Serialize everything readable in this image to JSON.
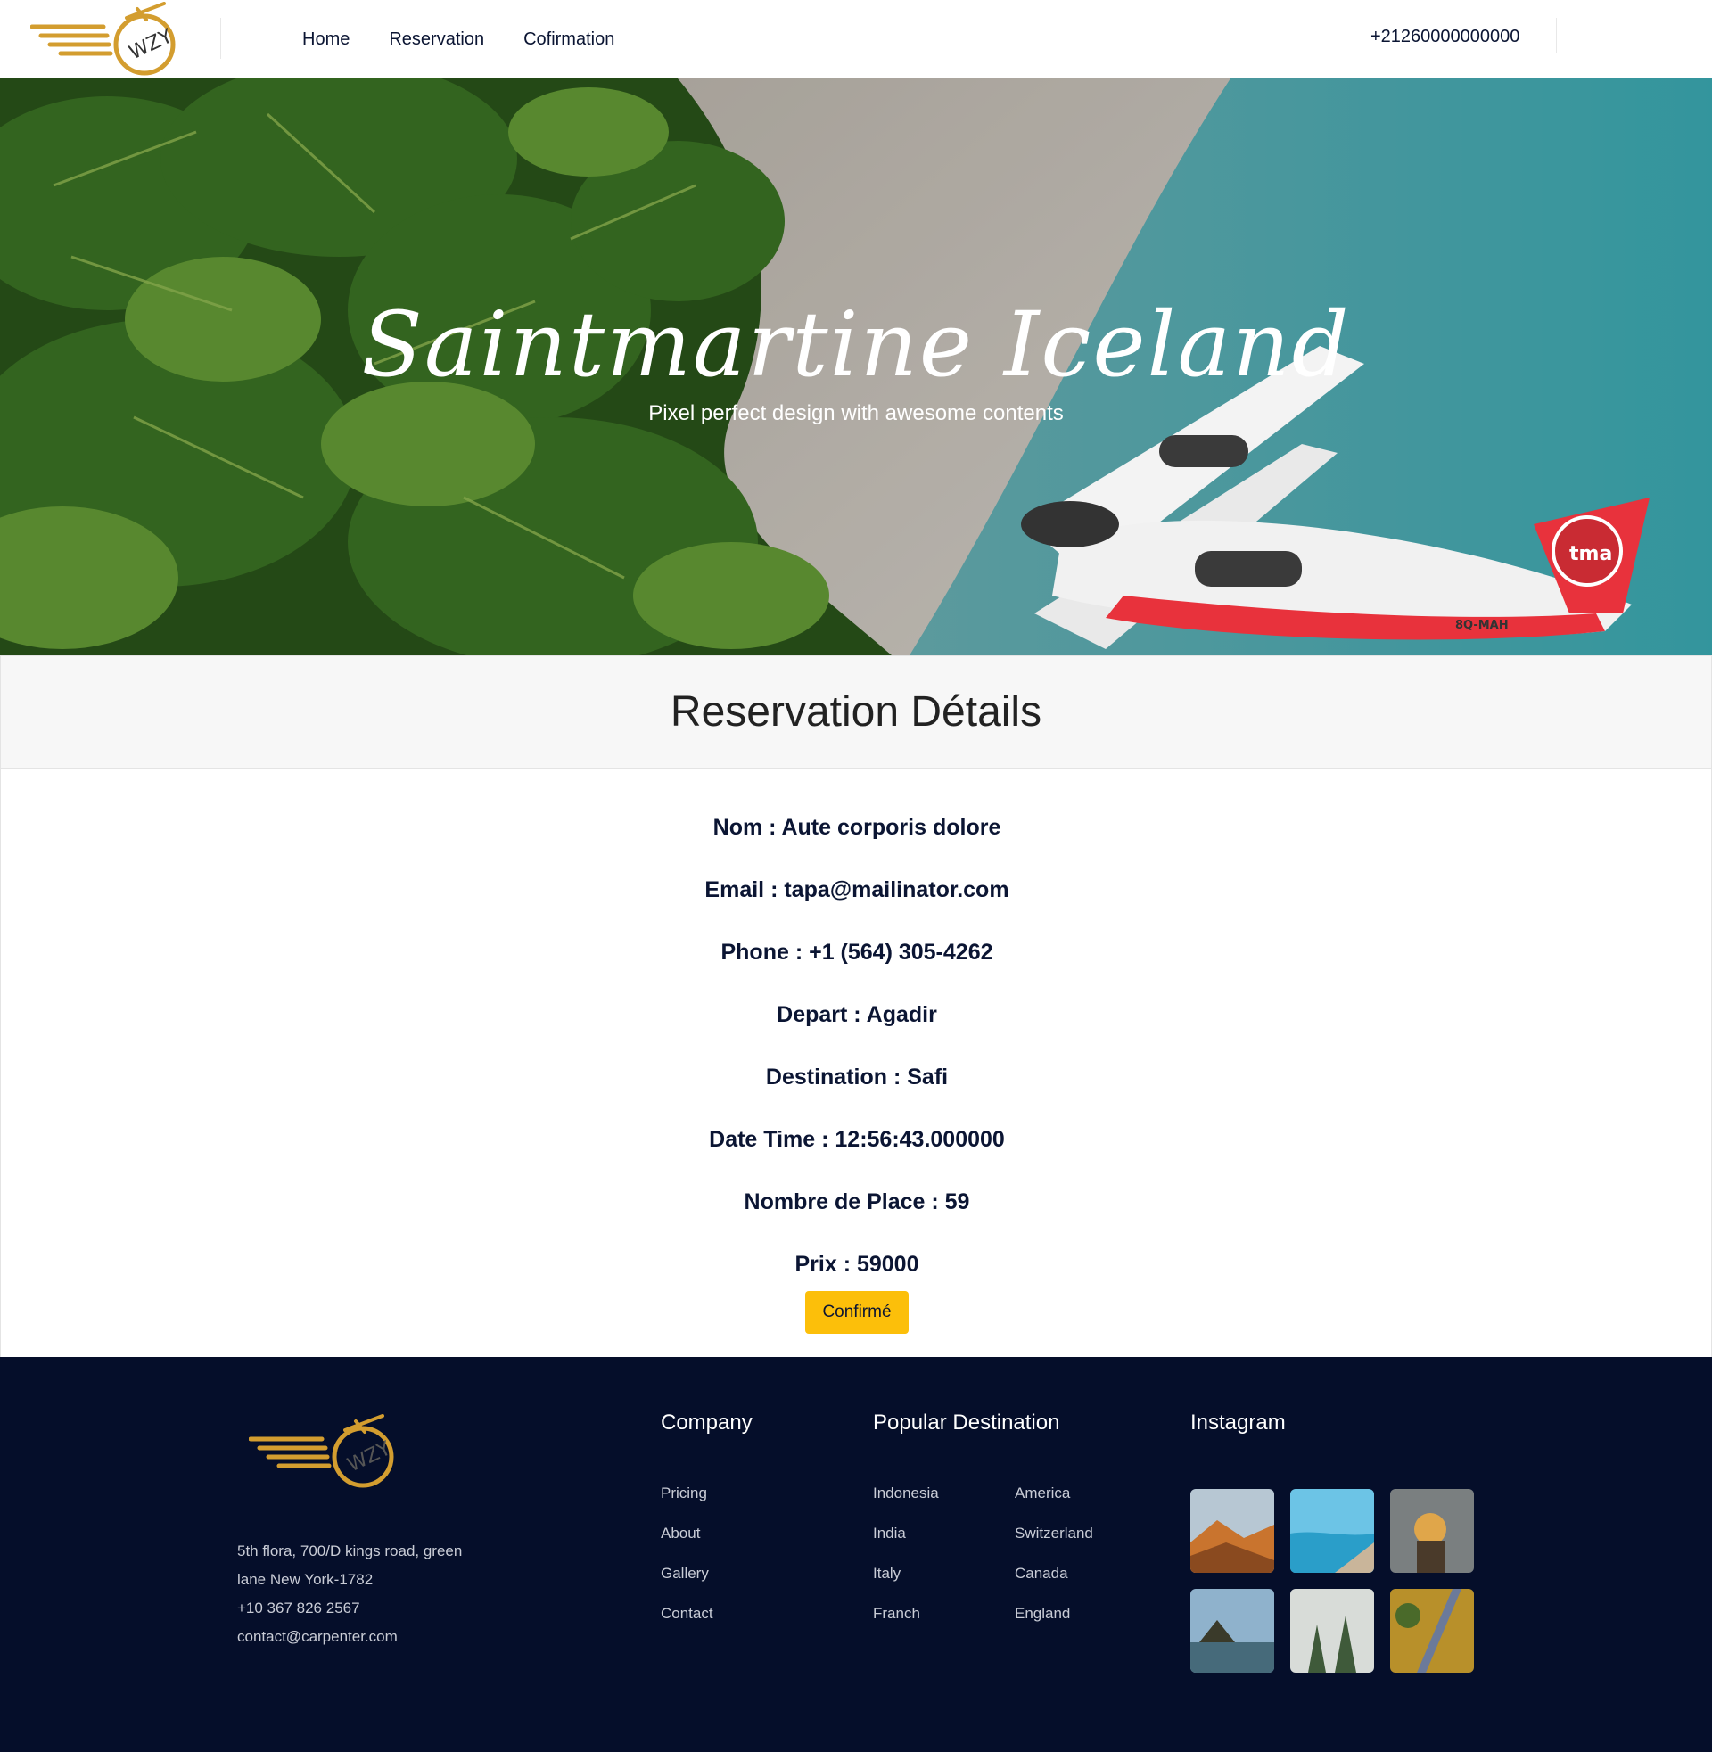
{
  "header": {
    "nav": [
      "Home",
      "Reservation",
      "Cofirmation"
    ],
    "phone": "+21260000000000"
  },
  "logo": {
    "text": "WZY"
  },
  "hero": {
    "title": "Saintmartine Iceland",
    "subtitle": "Pixel perfect design with awesome contents",
    "plane_reg": "8Q-MAH",
    "plane_brand": "tma"
  },
  "details": {
    "title": "Reservation Détails",
    "rows": [
      "Nom : Aute corporis dolore",
      "Email : tapa@mailinator.com",
      "Phone : +1 (564) 305-4262",
      "Depart : Agadir",
      "Destination : Safi",
      "Date Time : 12:56:43.000000",
      "Nombre de Place : 59",
      "Prix : 59000"
    ],
    "confirm_label": "Confirmé"
  },
  "footer": {
    "address": [
      "5th flora, 700/D kings road, green",
      "lane New York-1782",
      "+10 367 826 2567",
      "contact@carpenter.com"
    ],
    "company_title": "Company",
    "company_links": [
      "Pricing",
      "About",
      "Gallery",
      "Contact"
    ],
    "destination_title": "Popular Destination",
    "destinations_col1": [
      "Indonesia",
      "India",
      "Italy",
      "Franch"
    ],
    "destinations_col2": [
      "America",
      "Switzerland",
      "Canada",
      "England"
    ],
    "instagram_title": "Instagram"
  },
  "colors": {
    "accent": "#fcbf0a",
    "footer_bg": "#050e2a",
    "logo_gold": "#d39d2f"
  }
}
